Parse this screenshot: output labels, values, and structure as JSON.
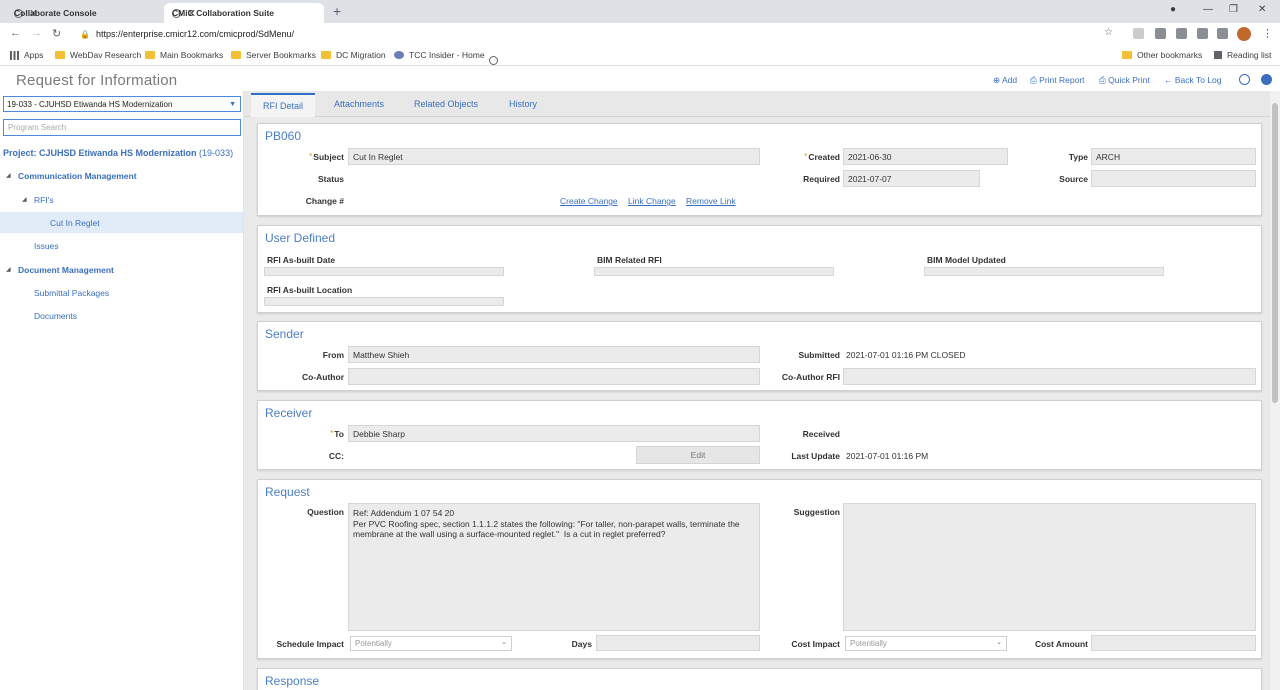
{
  "browser": {
    "tabs": [
      {
        "label": "Collaborate Console",
        "close": "✕"
      },
      {
        "label": "CMiC Collaboration Suite",
        "close": "✕"
      }
    ],
    "new_tab": "+",
    "url": "https://enterprise.cmicr12.com/cmicprod/SdMenu/",
    "bookmarks": [
      "Apps",
      "WebDav Research",
      "Main Bookmarks",
      "Server Bookmarks",
      "DC Migration",
      "TCC Insider - Home"
    ],
    "other_bookmarks": "Other bookmarks",
    "reading_list": "Reading list"
  },
  "app": {
    "title": "Request for Information",
    "toolbar": {
      "add": "Add",
      "print_report": "Print Report",
      "quick_print": "Quick Print",
      "back_to_log": "Back To Log"
    }
  },
  "sidebar": {
    "project_selector": "19-033 - CJUHSD Etiwanda HS Modernization",
    "program_search_placeholder": "Program Search",
    "project_label": "Project: CJUHSD Etiwanda HS Modernization",
    "project_code": "(19-033)",
    "tree": {
      "communication_management": "Communication Management",
      "rfis": "RFI's",
      "cut_in_reglet": "Cut In Reglet",
      "issues": "Issues",
      "document_management": "Document Management",
      "submittal_packages": "Submittal Packages",
      "documents": "Documents"
    }
  },
  "content_tabs": [
    "RFI Detail",
    "Attachments",
    "Related Objects",
    "History"
  ],
  "header_section": {
    "title": "PB060",
    "subject_label": "Subject",
    "subject": "Cut In Reglet",
    "status_label": "Status",
    "change_label": "Change #",
    "created_label": "Created",
    "created": "2021-06-30",
    "required_label": "Required",
    "required": "2021-07-07",
    "type_label": "Type",
    "type": "ARCH",
    "source_label": "Source",
    "create_change": "Create Change",
    "link_change": "Link Change",
    "remove_link": "Remove Link",
    "required_marker": "*"
  },
  "user_defined": {
    "title": "User Defined",
    "asbuilt_date": "RFI As-built Date",
    "bim_related": "BIM Related RFI",
    "bim_model_updated": "BIM Model Updated",
    "asbuilt_location": "RFI As-built Location"
  },
  "sender": {
    "title": "Sender",
    "from_label": "From",
    "from": "Matthew Shieh",
    "coauthor_label": "Co-Author",
    "submitted_label": "Submitted",
    "submitted": "2021-07-01 01:16 PM CLOSED",
    "coauthor_rfi_label": "Co-Author RFI"
  },
  "receiver": {
    "title": "Receiver",
    "to_label": "To",
    "to": "Debbie Sharp",
    "cc_label": "CC:",
    "edit": "Edit",
    "received_label": "Received",
    "last_update_label": "Last Update",
    "last_update": "2021-07-01 01:16 PM"
  },
  "request": {
    "title": "Request",
    "question_label": "Question",
    "question": "Ref: Addendum 1 07 54 20\nPer PVC Roofing spec, section 1.1.1.2 states the following: \"For taller, non-parapet walls, terminate the\nmembrane at the wall using a surface-mounted reglet.\"  Is a cut in reglet preferred?",
    "suggestion_label": "Suggestion",
    "schedule_impact_label": "Schedule Impact",
    "schedule_impact": "Potentially",
    "days_label": "Days",
    "cost_impact_label": "Cost Impact",
    "cost_impact": "Potentially",
    "cost_amount_label": "Cost Amount"
  },
  "response": {
    "title": "Response"
  },
  "colors": {
    "accent": "#3a6fbf",
    "required": "#e09a00",
    "panel_bg": "#eaeaea"
  }
}
